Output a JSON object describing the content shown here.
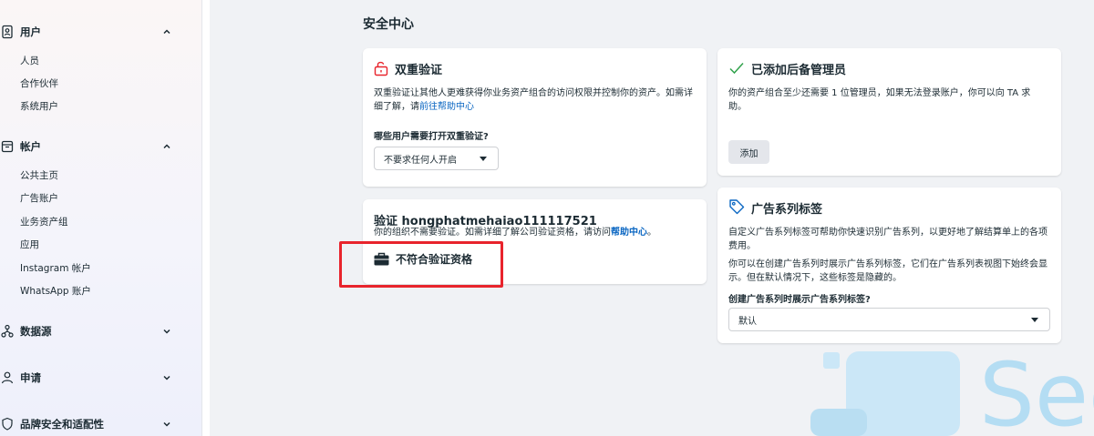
{
  "sidebar": {
    "sections": [
      {
        "label": "用户",
        "icon": "user-badge-icon",
        "expanded": true,
        "items": [
          "人员",
          "合作伙伴",
          "系统用户"
        ]
      },
      {
        "label": "帐户",
        "icon": "folder-icon",
        "expanded": true,
        "items": [
          "公共主页",
          "广告账户",
          "业务资产组",
          "应用",
          "Instagram 帐户",
          "WhatsApp 账户"
        ]
      },
      {
        "label": "数据源",
        "icon": "data-source-icon",
        "expanded": false,
        "items": []
      },
      {
        "label": "申请",
        "icon": "person-request-icon",
        "expanded": false,
        "items": []
      },
      {
        "label": "品牌安全和适配性",
        "icon": "shield-icon",
        "expanded": false,
        "items": []
      }
    ]
  },
  "main": {
    "title": "安全中心",
    "two_factor": {
      "title": "双重验证",
      "desc_prefix": "双重验证让其他人更难获得你业务资产组合的访问权限并控制你的资产。如需详细了解，请",
      "desc_link": "前往帮助中心",
      "question": "哪些用户需要打开双重验证?",
      "select_value": "不要求任何人开启"
    },
    "backup_admin": {
      "title": "已添加后备管理员",
      "desc": "你的资产组合至少还需要 1 位管理员，如果无法登录账户，你可以向 TA 求助。",
      "button": "添加"
    },
    "verification": {
      "title": "验证 hongphatmehaiao111117521",
      "desc_prefix": "你的组织不需要验证。如需详细了解公司验证资格，请访问",
      "desc_link": "帮助中心",
      "desc_suffix": "。",
      "status": "不符合验证资格"
    },
    "campaign_tags": {
      "title": "广告系列标签",
      "desc1": "自定义广告系列标签可帮助你快速识别广告系列，以更好地了解结算单上的各项费用。",
      "desc2": "你可以在创建广告系列时展示广告系列标签，它们在广告系列表视图下始终会显示。但在默认情况下，这些标签是隐藏的。",
      "question": "创建广告系列时展示广告系列标签?",
      "select_value": "默认"
    }
  },
  "watermark": {
    "text": "Sec"
  },
  "colors": {
    "link": "#0a66c2",
    "highlight": "#e8242c",
    "unlock_icon": "#e8242c",
    "check_icon": "#31a24c"
  }
}
